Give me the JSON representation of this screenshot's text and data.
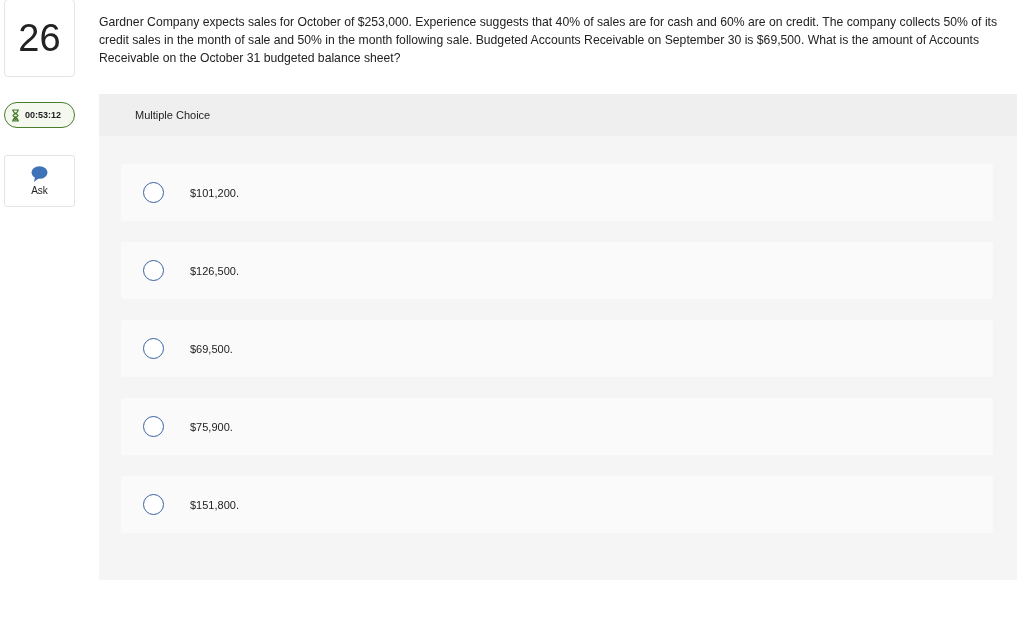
{
  "question": {
    "number": "26",
    "text": "Gardner Company expects sales for October of $253,000. Experience suggests that 40% of sales are for cash and 60% are on credit. The company collects 50% of its credit sales in the month of sale and 50% in the month following sale. Budgeted Accounts Receivable on September 30 is $69,500. What is the amount of Accounts Receivable on the October 31 budgeted balance sheet?"
  },
  "timer": "00:53:12",
  "ask_button": "Ask",
  "answer_panel": {
    "title": "Multiple Choice",
    "options": [
      {
        "label": "$101,200.",
        "selected": false
      },
      {
        "label": "$126,500.",
        "selected": false
      },
      {
        "label": "$69,500.",
        "selected": false
      },
      {
        "label": "$75,900.",
        "selected": false
      },
      {
        "label": "$151,800.",
        "selected": false
      }
    ]
  }
}
